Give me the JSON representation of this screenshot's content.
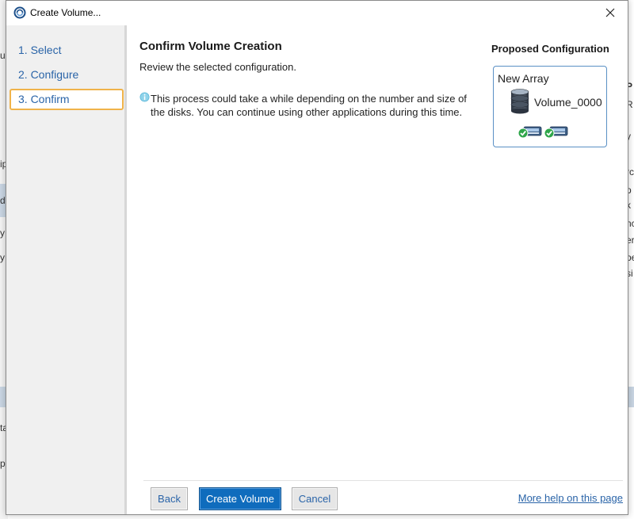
{
  "window": {
    "title": "Create Volume..."
  },
  "steps": [
    {
      "label": "1. Select"
    },
    {
      "label": "2. Configure"
    },
    {
      "label": "3. Confirm"
    }
  ],
  "main": {
    "heading": "Confirm Volume Creation",
    "subheading": "Review the selected configuration.",
    "info": "This process could take a while depending on the number and size of the disks. You can continue using other applications during this time."
  },
  "proposed": {
    "title": "Proposed Configuration",
    "array_label": "New Array",
    "volume_label": "Volume_0000",
    "icons": [
      "database-icon",
      "disk-ok-icon",
      "disk-ok-icon"
    ]
  },
  "footer": {
    "back_label": "Back",
    "create_label": "Create Volume",
    "cancel_label": "Cancel",
    "help_label": "More help on this page"
  },
  "background": {
    "left_fragments": [
      "u",
      "ip",
      "d",
      "y",
      "y",
      "ta",
      "p"
    ],
    "right_fragments": [
      "P",
      "R",
      "y",
      "rc",
      "p",
      "k",
      "nc",
      "er",
      "pe",
      "si"
    ]
  },
  "colors": {
    "accent": "#0f6cbd",
    "link": "#2a64a8",
    "active_step_border": "#f0b34a",
    "config_border": "#5a90c5"
  }
}
